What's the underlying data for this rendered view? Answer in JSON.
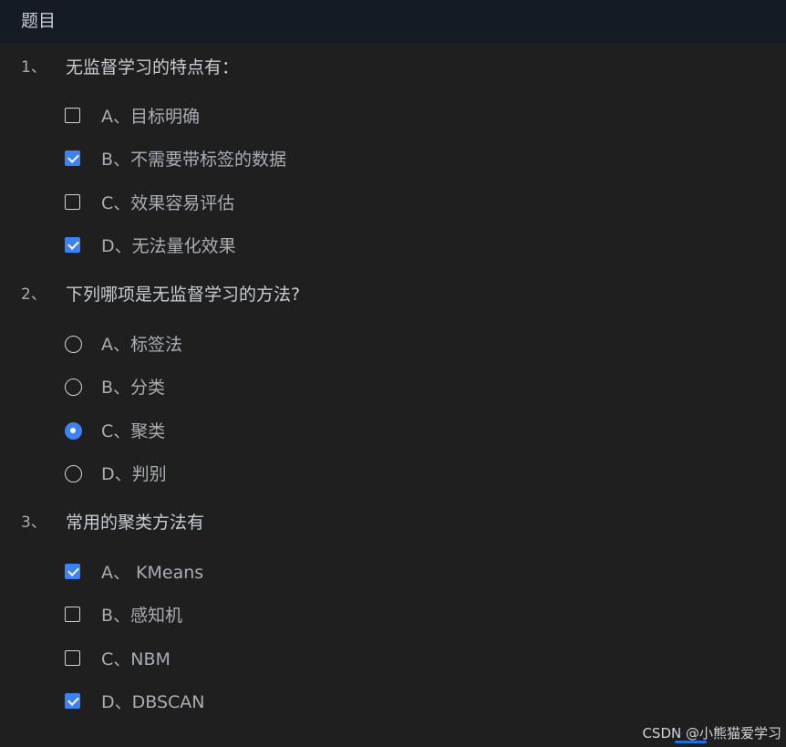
{
  "header": {
    "title": "题目"
  },
  "questions": [
    {
      "number": "1、",
      "text": "无监督学习的特点有：",
      "type": "checkbox",
      "options": [
        {
          "label": "A、目标明确",
          "checked": false
        },
        {
          "label": "B、不需要带标签的数据",
          "checked": true
        },
        {
          "label": "C、效果容易评估",
          "checked": false
        },
        {
          "label": "D、无法量化效果",
          "checked": true
        }
      ]
    },
    {
      "number": "2、",
      "text": "下列哪项是无监督学习的方法?",
      "type": "radio",
      "options": [
        {
          "label": "A、标签法",
          "checked": false
        },
        {
          "label": "B、分类",
          "checked": false
        },
        {
          "label": "C、聚类",
          "checked": true
        },
        {
          "label": "D、判别",
          "checked": false
        }
      ]
    },
    {
      "number": "3、",
      "text": "常用的聚类方法有",
      "type": "checkbox",
      "options": [
        {
          "label": "A、 KMeans",
          "checked": true
        },
        {
          "label": "B、感知机",
          "checked": false
        },
        {
          "label": "C、NBM",
          "checked": false
        },
        {
          "label": "D、DBSCAN",
          "checked": true
        }
      ]
    }
  ],
  "watermark": "CSDN @小熊猫爱学习",
  "colors": {
    "background": "#1f1f1f",
    "header_background": "#141b24",
    "accent": "#3b82f6",
    "text": "#a9adb3"
  }
}
